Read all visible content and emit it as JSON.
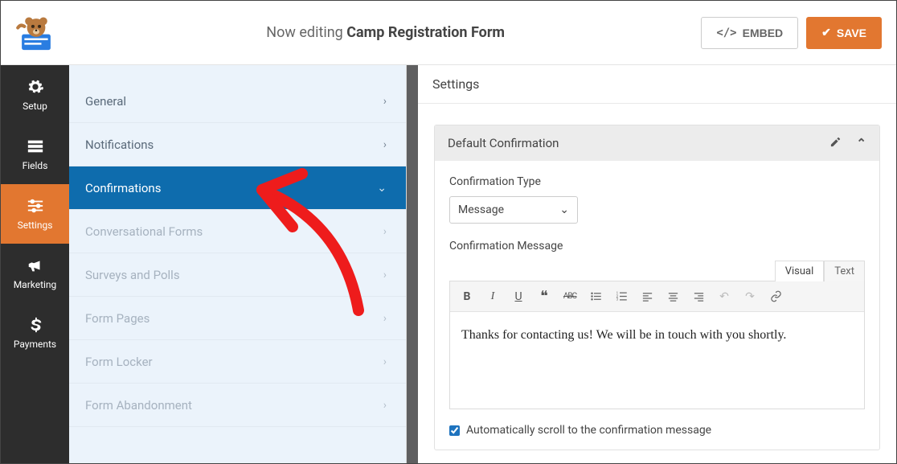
{
  "colors": {
    "accent": "#e27730",
    "nav_active": "#0e6cad",
    "rail_bg": "#2d2d2d"
  },
  "topbar": {
    "editing_prefix": "Now editing",
    "form_name": "Camp Registration Form",
    "embed_label": "EMBED",
    "save_label": "SAVE"
  },
  "rail": {
    "items": [
      {
        "key": "setup",
        "label": "Setup",
        "icon": "gear-icon"
      },
      {
        "key": "fields",
        "label": "Fields",
        "icon": "list-icon"
      },
      {
        "key": "settings",
        "label": "Settings",
        "icon": "sliders-icon",
        "active": true
      },
      {
        "key": "marketing",
        "label": "Marketing",
        "icon": "bullhorn-icon"
      },
      {
        "key": "payments",
        "label": "Payments",
        "icon": "dollar-icon"
      }
    ]
  },
  "panel": {
    "items": [
      {
        "label": "General",
        "state": "normal"
      },
      {
        "label": "Notifications",
        "state": "normal"
      },
      {
        "label": "Confirmations",
        "state": "active"
      },
      {
        "label": "Conversational Forms",
        "state": "muted"
      },
      {
        "label": "Surveys and Polls",
        "state": "muted"
      },
      {
        "label": "Form Pages",
        "state": "muted"
      },
      {
        "label": "Form Locker",
        "state": "muted"
      },
      {
        "label": "Form Abandonment",
        "state": "muted"
      }
    ]
  },
  "main": {
    "heading": "Settings",
    "card_title": "Default Confirmation",
    "type_label": "Confirmation Type",
    "type_value": "Message",
    "message_label": "Confirmation Message",
    "editor_tabs": {
      "visual": "Visual",
      "text": "Text"
    },
    "editor_content": "Thanks for contacting us! We will be in touch with you shortly.",
    "autoscroll_label": "Automatically scroll to the confirmation message",
    "autoscroll_checked": true
  }
}
